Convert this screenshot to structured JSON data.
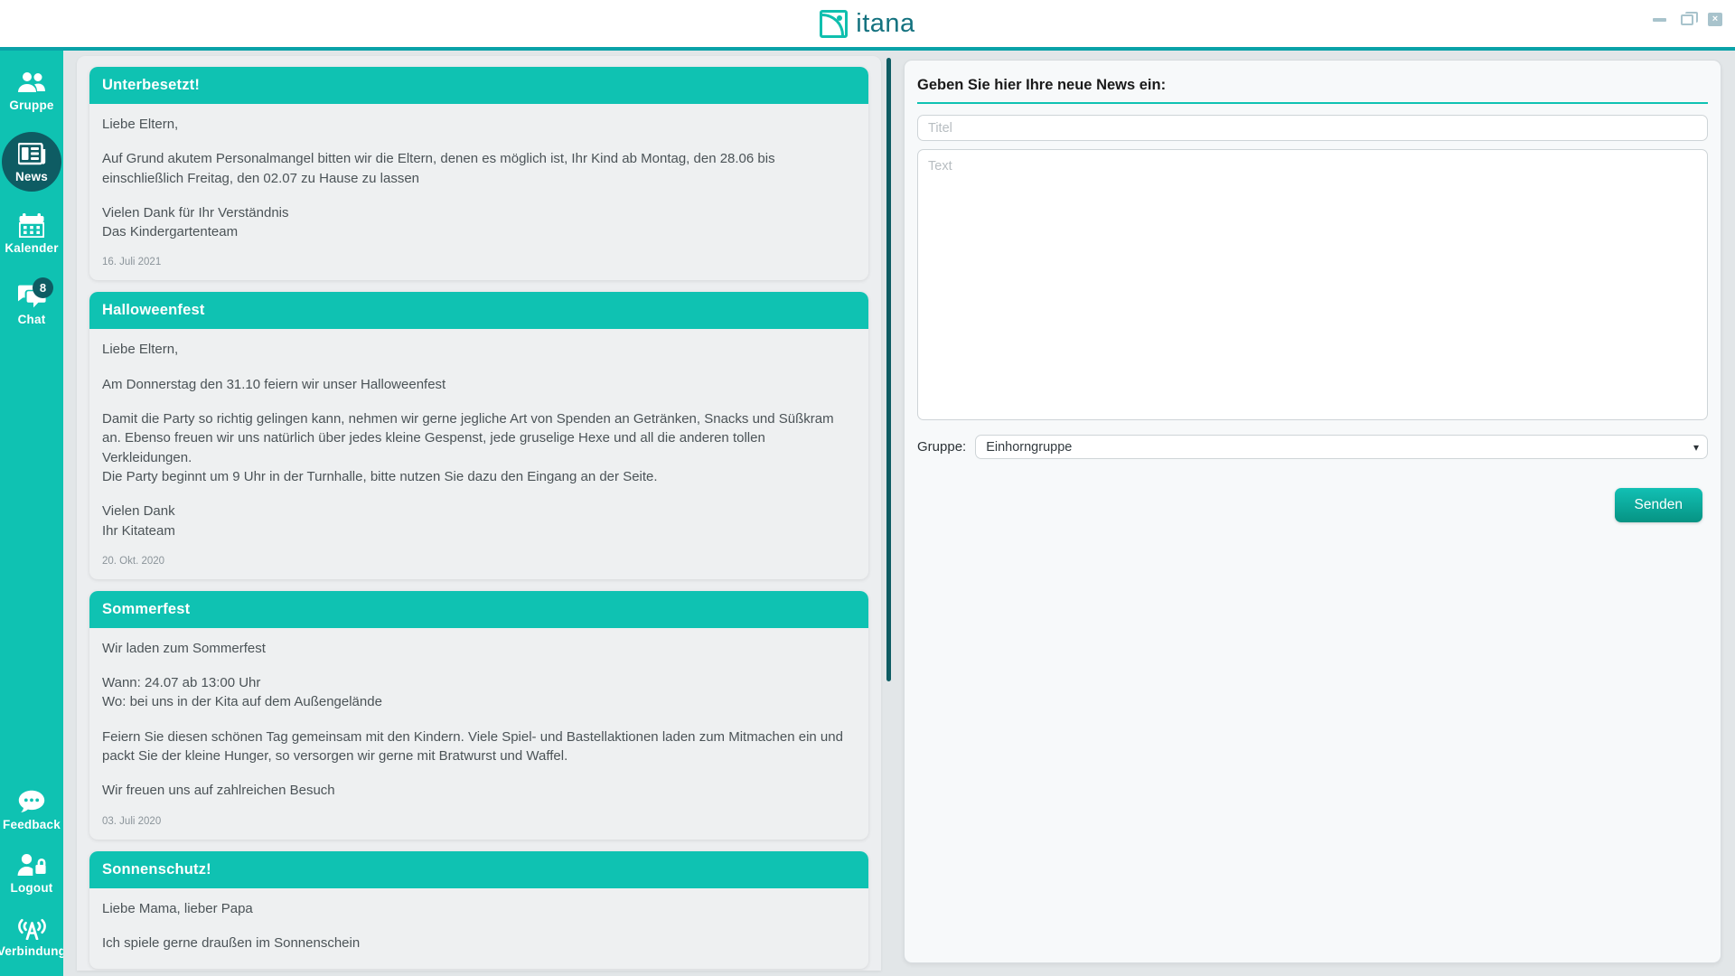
{
  "app": {
    "brand_name": "itana",
    "window_controls": {
      "minimize": "minimize-icon",
      "restore": "restore-icon",
      "close": "×"
    }
  },
  "sidebar": {
    "items": [
      {
        "id": "gruppe",
        "label": "Gruppe",
        "icon": "users-icon",
        "active": false,
        "badge": null
      },
      {
        "id": "news",
        "label": "News",
        "icon": "news-icon",
        "active": true,
        "badge": null
      },
      {
        "id": "kalender",
        "label": "Kalender",
        "icon": "calendar-icon",
        "active": false,
        "badge": null
      },
      {
        "id": "chat",
        "label": "Chat",
        "icon": "chat-icon",
        "active": false,
        "badge": "8"
      },
      {
        "id": "feedback",
        "label": "Feedback",
        "icon": "speech-bubble-icon",
        "active": false,
        "badge": null
      },
      {
        "id": "logout",
        "label": "Logout",
        "icon": "user-lock-icon",
        "active": false,
        "badge": null
      },
      {
        "id": "verbindung",
        "label": "Verbindung",
        "icon": "antenna-icon",
        "active": false,
        "badge": null
      }
    ]
  },
  "news": {
    "cards": [
      {
        "title": "Unterbesetzt!",
        "paragraphs": [
          "Liebe Eltern,",
          "Auf Grund akutem Personalmangel bitten wir die Eltern, denen es möglich ist, Ihr Kind ab Montag, den 28.06 bis einschließlich Freitag, den 02.07 zu Hause zu lassen",
          "Vielen Dank für Ihr Verständnis\nDas Kindergartenteam"
        ],
        "date": "16. Juli 2021"
      },
      {
        "title": "Halloweenfest",
        "paragraphs": [
          "Liebe Eltern,",
          "Am Donnerstag den 31.10 feiern wir unser Halloweenfest",
          "Damit die Party so richtig gelingen kann, nehmen wir gerne jegliche Art von Spenden an Getränken, Snacks und Süßkram an. Ebenso freuen wir uns natürlich über jedes kleine Gespenst, jede gruselige Hexe und all die anderen tollen Verkleidungen.\nDie Party beginnt um 9 Uhr in der Turnhalle, bitte nutzen Sie dazu den Eingang an der Seite.",
          "Vielen Dank\nIhr Kitateam"
        ],
        "date": "20. Okt. 2020"
      },
      {
        "title": "Sommerfest",
        "paragraphs": [
          "Wir laden zum Sommerfest",
          "Wann: 24.07 ab 13:00 Uhr\nWo: bei uns in der Kita auf dem Außengelände",
          "Feiern Sie diesen schönen Tag gemeinsam mit den Kindern. Viele Spiel- und Bastellaktionen laden zum Mitmachen ein und packt Sie der kleine Hunger, so versorgen wir gerne mit Bratwurst und Waffel.",
          "Wir freuen uns auf zahlreichen Besuch"
        ],
        "date": "03. Juli 2020"
      },
      {
        "title": "Sonnenschutz!",
        "paragraphs": [
          "Liebe Mama, lieber Papa",
          "Ich spiele gerne draußen im Sonnenschein"
        ],
        "date": ""
      }
    ]
  },
  "form": {
    "heading": "Geben Sie hier Ihre neue News ein:",
    "title_placeholder": "Titel",
    "title_value": "",
    "text_placeholder": "Text",
    "text_value": "",
    "group_label": "Gruppe:",
    "group_selected": "Einhorngruppe",
    "group_options": [
      "Einhorngruppe"
    ],
    "submit_label": "Senden"
  },
  "colors": {
    "teal": "#0fc2b2",
    "teal_dark": "#0e5c63",
    "teal_line": "#0aa2a8",
    "brand_text": "#14727f",
    "page_bg": "#e2e6e8",
    "card_bg": "#eef0f1"
  }
}
